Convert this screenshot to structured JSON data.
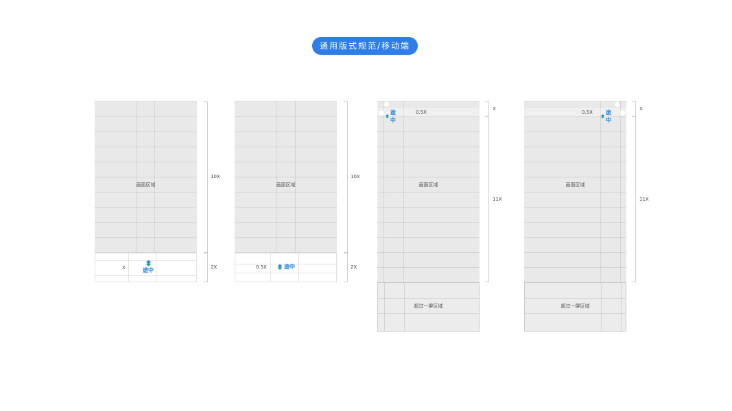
{
  "title": "通用版式规范/移动端",
  "colors": {
    "accent": "#2d7ee8",
    "area": "#e9e9e9",
    "logo_blue": "#1f7de0",
    "logo_green": "#22b07d"
  },
  "logo": {
    "name": "途中",
    "icon": "logo-mark-icon"
  },
  "panels": [
    {
      "area_label": "画面区域",
      "dims": {
        "area": "10X",
        "footer": "2X",
        "logo_margin": "X"
      }
    },
    {
      "area_label": "画面区域",
      "dims": {
        "area": "10X",
        "footer": "2X",
        "logo_margin": "0.5X"
      }
    },
    {
      "area_label": "画面区域",
      "over_label": "超过一屏区域",
      "dims": {
        "header": "X",
        "area": "11X",
        "logo_margin": "0.5X"
      }
    },
    {
      "area_label": "画面区域",
      "over_label": "超过一屏区域",
      "dims": {
        "header": "X",
        "area": "11X",
        "logo_margin": "0.5X"
      }
    }
  ]
}
